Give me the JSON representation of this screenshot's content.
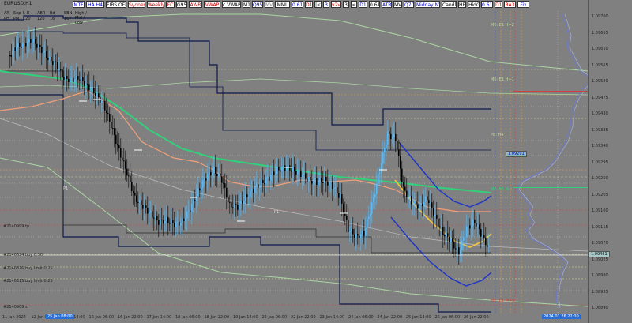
{
  "chart": {
    "symbol": "EURUSD,H1",
    "colors": {
      "background": "#808080",
      "bull_candle": "#5fb8f0",
      "bear_candle": "#000000",
      "ma_green": "#31d07a",
      "salmon_line": "#f0a07a",
      "band_navy": "#0b1a4a",
      "pale_green": "#a9d6a0",
      "regression": "#1c34c8",
      "regression_mid": "#f5c63a",
      "pivot_red": "#d04040",
      "guide_orange": "#e89a2c"
    }
  },
  "toolbar": {
    "buttons": [
      {
        "label": "MTF",
        "bg": "#ffffff",
        "fg": "#0000cc"
      },
      {
        "label": "HA H4",
        "bg": "#ffffff",
        "fg": "#0000cc"
      },
      {
        "label": "FIBS OFF",
        "bg": "#ffffff",
        "fg": "#000000"
      },
      {
        "label": "Sydney",
        "bg": "#ffffff",
        "fg": "#cc0000"
      },
      {
        "label": "Weekly",
        "bg": "#ffffff",
        "fg": "#cc0000"
      },
      {
        "label": "FC",
        "bg": "#ffffff",
        "fg": "#cc0000"
      },
      {
        "label": "G95",
        "bg": "#ffffff",
        "fg": "#000000"
      },
      {
        "label": "AWR",
        "bg": "#ffffff",
        "fg": "#cc0000"
      },
      {
        "label": "VWAP",
        "bg": "#ffffff",
        "fg": "#cc0000"
      },
      {
        "label": "c.VWAP",
        "bg": "#ffffff",
        "fg": "#000000"
      },
      {
        "label": "M1",
        "bg": "#ffffff",
        "fg": "#000000"
      },
      {
        "label": "Q95",
        "bg": "#ffffff",
        "fg": "#0000cc"
      },
      {
        "label": "MV",
        "bg": "#ffffff",
        "fg": "#777777"
      },
      {
        "label": "MML",
        "bg": "#ffffff",
        "fg": "#000000"
      },
      {
        "label": "0.61",
        "bg": "#ffffff",
        "fg": "#0000cc"
      },
      {
        "label": "D1",
        "bg": "#ffffff",
        "fg": "#cc0000"
      },
      {
        "label": "|<",
        "bg": "#ffffff",
        "fg": "#000000"
      },
      {
        "label": "3",
        "bg": "#ffffff",
        "fg": "#0000cc"
      },
      {
        "label": "v2v",
        "bg": "#ffffff",
        "fg": "#cc0000"
      },
      {
        "label": "3",
        "bg": "#ffffff",
        "fg": "#000000"
      },
      {
        "label": "<",
        "bg": "#ffffff",
        "fg": "#000000"
      },
      {
        "label": "D1",
        "bg": "#ffffff",
        "fg": "#0000cc"
      },
      {
        "label": "0.61",
        "bg": "#ffffff",
        "fg": "#000000"
      },
      {
        "label": "ATR",
        "bg": "#ffffff",
        "fg": "#0000cc"
      },
      {
        "label": "MV",
        "bg": "#ffffff",
        "fg": "#000000"
      },
      {
        "label": "Q70",
        "bg": "#ffffff",
        "fg": "#0000cc"
      },
      {
        "label": "Midday NY",
        "bg": "#ffffff",
        "fg": "#0000cc"
      },
      {
        "label": "Candle",
        "bg": "#ffffff",
        "fg": "#000000"
      },
      {
        "label": "HB",
        "bg": "#ffffff",
        "fg": "#000000"
      },
      {
        "label": "HidG",
        "bg": "#ffffff",
        "fg": "#000000"
      },
      {
        "label": "0.61",
        "bg": "#ffffff",
        "fg": "#0000cc"
      },
      {
        "label": "D1",
        "bg": "#ffffff",
        "fg": "#cc0000"
      },
      {
        "label": "RA3",
        "bg": "#ffffff",
        "fg": "#cc0000"
      },
      {
        "label": "Fix",
        "bg": "#ffffff",
        "fg": "#0000cc"
      }
    ]
  },
  "stats": {
    "headers": [
      "AR",
      "Sep",
      "I.-R",
      "ABR",
      "Bd",
      "SBN",
      "High / Mid / Low"
    ],
    "values": [
      "PH",
      "PM",
      "120",
      "120",
      "16",
      "167",
      ""
    ]
  },
  "price_axis": {
    "labels": [
      "1.09700",
      "1.09655",
      "1.09610",
      "1.09565",
      "1.09520",
      "1.09475",
      "1.09430",
      "1.09385",
      "1.09340",
      "1.09295",
      "1.09250",
      "1.09205",
      "1.09160",
      "1.09115",
      "1.09070",
      "1.09025",
      "1.08980",
      "1.08935",
      "1.08890"
    ],
    "current_price": "1.09461"
  },
  "time_axis": {
    "labels": [
      "11 Jan 2024",
      "12 Jan 08:00",
      "15 Jan 14:00",
      "16 Jan 06:00",
      "16 Jan 22:00",
      "17 Jan 14:00",
      "18 Jan 06:00",
      "18 Jan 22:00",
      "19 Jan 14:00",
      "22 Jan 06:00",
      "22 Jan 22:00",
      "23 Jan 14:00",
      "24 Jan 06:00",
      "24 Jan 22:00",
      "25 Jan 14:00",
      "26 Jan 06:00",
      "26 Jan 22:00"
    ],
    "highlight": "25 Jan 08:00",
    "highlight_right": "2024.01.26 22:00"
  },
  "annotations": {
    "order_labels": [
      "#2140999 tp",
      "#2140624 buy 0.50",
      "#2140316 buy limit 0.25",
      "#2140315 buy limit 0.25",
      "#2140909 sl"
    ],
    "zone_labels": [
      "M6: E1 H+2",
      "M6: E1 H+1",
      "P8: H4",
      "M6: E1 M-1",
      "M6: E1 M+0"
    ],
    "pivot_tags": [
      "P1",
      "P1"
    ],
    "level_tag": "1.09291"
  }
}
